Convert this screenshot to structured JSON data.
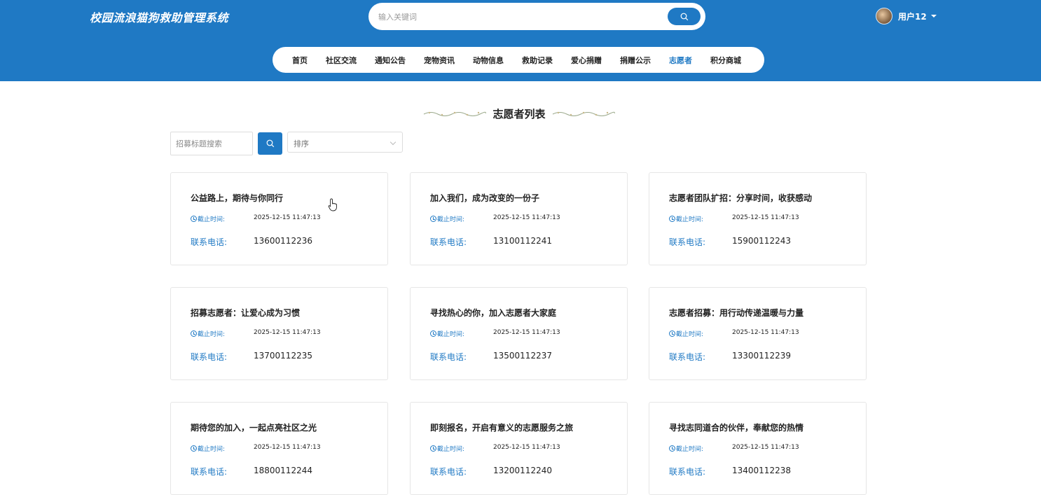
{
  "header": {
    "brand": "校园流浪猫狗救助管理系统",
    "search_placeholder": "输入关键词",
    "user_name": "用户12"
  },
  "nav": {
    "items": [
      "首页",
      "社区交流",
      "通知公告",
      "宠物资讯",
      "动物信息",
      "救助记录",
      "爱心捐赠",
      "捐赠公示",
      "志愿者",
      "积分商城"
    ],
    "active": "志愿者"
  },
  "section": {
    "title": "志愿者列表"
  },
  "filter": {
    "search_placeholder": "招募标题搜索",
    "sort_label": "排序"
  },
  "card_labels": {
    "deadline": "截止时间:",
    "phone": "联系电话:"
  },
  "cards": [
    {
      "title": "公益路上，期待与你同行",
      "deadline": "2025-12-15 11:47:13",
      "phone": "13600112236"
    },
    {
      "title": "加入我们，成为改变的一份子",
      "deadline": "2025-12-15 11:47:13",
      "phone": "13100112241"
    },
    {
      "title": "志愿者团队扩招：分享时间，收获感动",
      "deadline": "2025-12-15 11:47:13",
      "phone": "15900112243"
    },
    {
      "title": "招募志愿者：让爱心成为习惯",
      "deadline": "2025-12-15 11:47:13",
      "phone": "13700112235"
    },
    {
      "title": "寻找热心的你，加入志愿者大家庭",
      "deadline": "2025-12-15 11:47:13",
      "phone": "13500112237"
    },
    {
      "title": "志愿者招募：用行动传递温暖与力量",
      "deadline": "2025-12-15 11:47:13",
      "phone": "13300112239"
    },
    {
      "title": "期待您的加入，一起点亮社区之光",
      "deadline": "2025-12-15 11:47:13",
      "phone": "18800112244"
    },
    {
      "title": "即刻报名，开启有意义的志愿服务之旅",
      "deadline": "2025-12-15 11:47:13",
      "phone": "13200112240"
    },
    {
      "title": "寻找志同道合的伙伴，奉献您的热情",
      "deadline": "2025-12-15 11:47:13",
      "phone": "13400112238"
    }
  ],
  "colors": {
    "primary": "#1f79c4",
    "text": "#222222",
    "border": "#e6e6e6"
  },
  "icons": {
    "search": "search-icon",
    "clock": "clock-icon",
    "caret": "caret-down-icon",
    "chevron": "chevron-down-icon"
  }
}
